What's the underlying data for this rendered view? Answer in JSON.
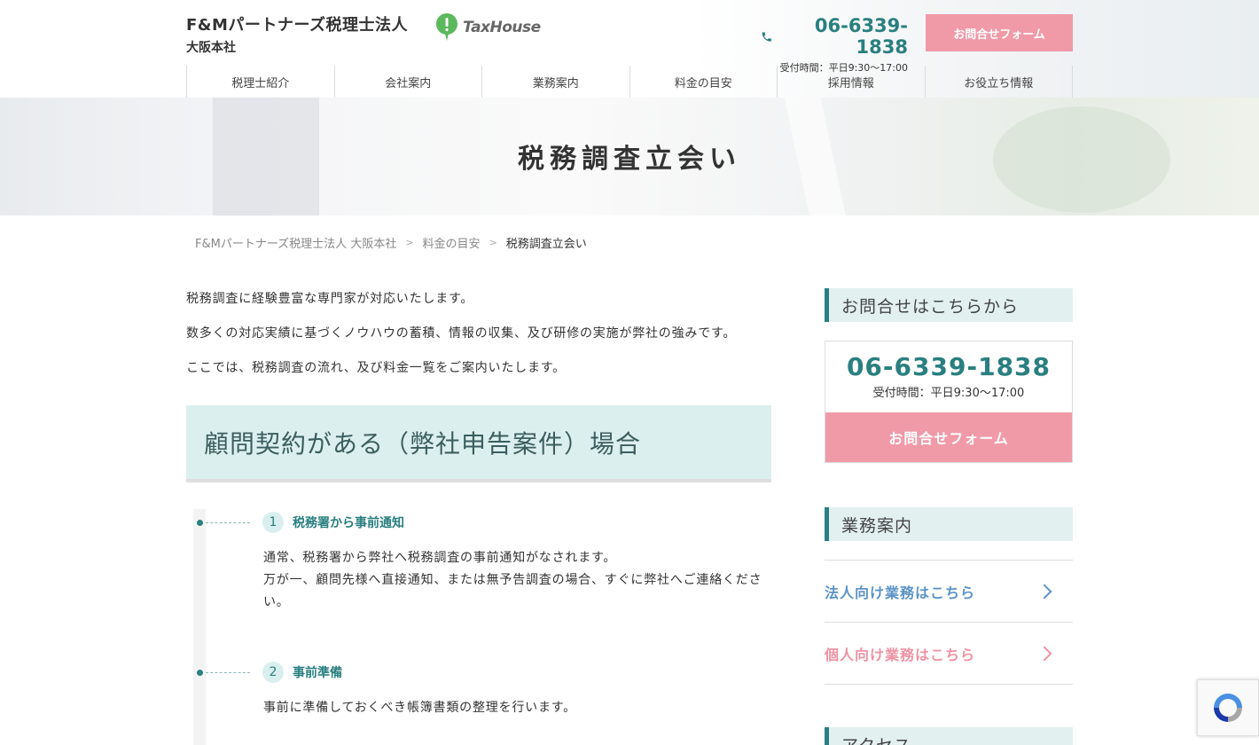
{
  "header": {
    "company_name": "F&Mパートナーズ税理士法人",
    "branch": "大阪本社",
    "logo_text": "TaxHouse",
    "tel": "06-6339-1838",
    "hours": "受付時間：平日9:30〜17:00",
    "contact_label": "お問合せフォーム"
  },
  "nav": {
    "items": [
      {
        "label": "税理士紹介"
      },
      {
        "label": "会社案内"
      },
      {
        "label": "業務案内"
      },
      {
        "label": "料金の目安"
      },
      {
        "label": "採用情報"
      },
      {
        "label": "お役立ち情報"
      }
    ]
  },
  "hero": {
    "title": "税務調査立会い"
  },
  "breadcrumb": {
    "items": [
      "F&Mパートナーズ税理士法人 大阪本社",
      "料金の目安"
    ],
    "current": "税務調査立会い"
  },
  "main": {
    "intro": [
      "税務調査に経験豊富な専門家が対応いたします。",
      "数多くの対応実績に基づくノウハウの蓄積、情報の収集、及び研修の実施が弊社の強みです。",
      "ここでは、税務調査の流れ、及び料金一覧をご案内いたします。"
    ],
    "section_title": "顧問契約がある（弊社申告案件）場合",
    "steps": [
      {
        "num": "1",
        "title": "税務署から事前通知",
        "lines": [
          "通常、税務署から弊社へ税務調査の事前通知がなされます。",
          "万が一、顧問先様へ直接通知、または無予告調査の場合、すぐに弊社へご連絡ください。"
        ]
      },
      {
        "num": "2",
        "title": "事前準備",
        "lines": [
          "事前に準備しておくべき帳簿書類の整理を行います。"
        ]
      }
    ]
  },
  "sidebar": {
    "contact_heading": "お問合せはこちらから",
    "tel": "06-6339-1838",
    "hours": "受付時間：平日9:30〜17:00",
    "contact_button": "お問合せフォーム",
    "services_heading": "業務案内",
    "links": [
      {
        "label": "法人向け業務はこちら"
      },
      {
        "label": "個人向け業務はこちら"
      }
    ],
    "access_heading": "アクセス"
  },
  "colors": {
    "accent": "#2a7f80",
    "pink": "#f09aa8",
    "section_bg": "#dcefef",
    "corp_link": "#5b93c7",
    "indiv_link": "#ef93a3"
  }
}
